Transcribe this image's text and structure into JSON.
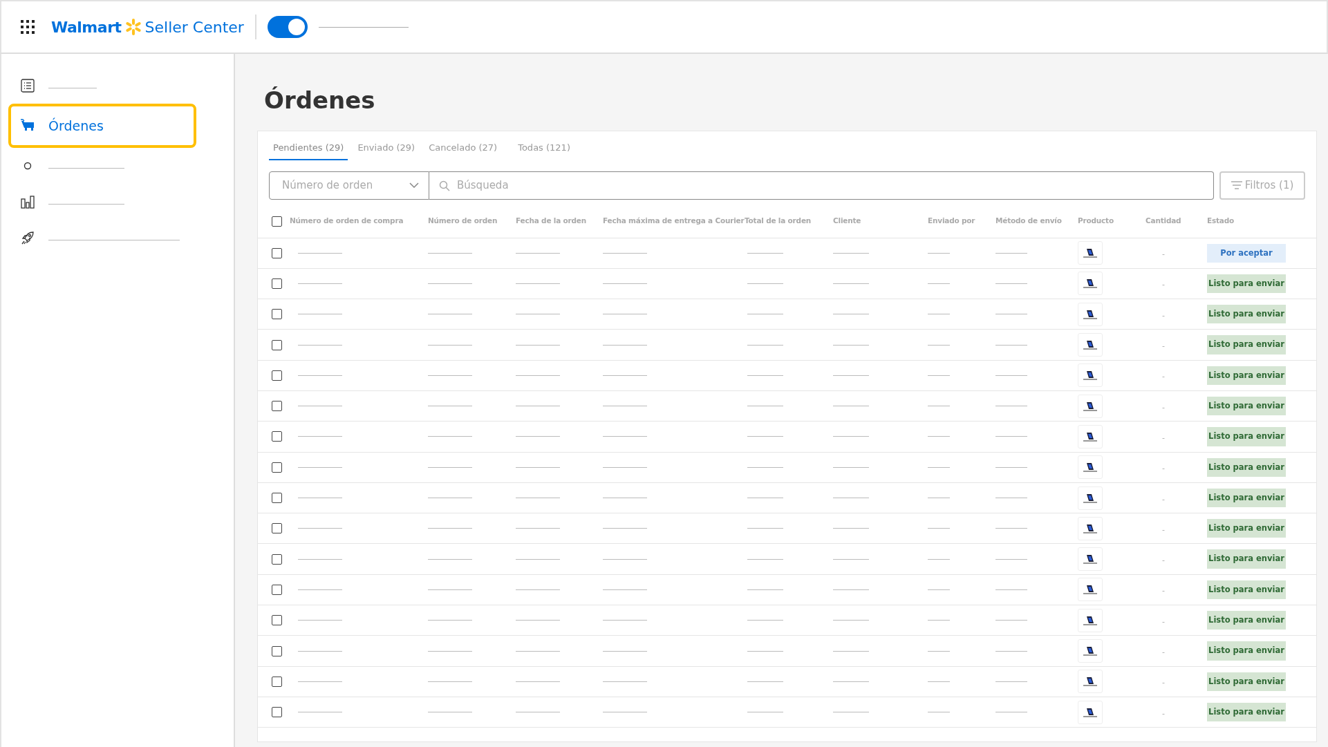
{
  "header": {
    "brand": "Walmart",
    "product": "Seller Center",
    "toggle": {
      "on": true
    }
  },
  "sidebar": {
    "items": [
      {
        "kind": "list",
        "selected": false
      },
      {
        "kind": "cart",
        "label": "Órdenes",
        "selected": true
      },
      {
        "kind": "circle",
        "selected": false
      },
      {
        "kind": "chart",
        "selected": false
      },
      {
        "kind": "rocket",
        "selected": false
      }
    ]
  },
  "page": {
    "title": "Órdenes"
  },
  "tabs": [
    {
      "label": "Pendientes (29)",
      "selected": true
    },
    {
      "label": "Enviado (29)",
      "selected": false
    },
    {
      "label": "Cancelado (27)",
      "selected": false
    },
    {
      "label": "Todas (121)",
      "selected": false
    }
  ],
  "search": {
    "dropdown": "Número de orden",
    "placeholder": "Búsqueda",
    "filters": "Filtros (1)"
  },
  "table": {
    "select_all": {
      "checked": false
    },
    "columns": [
      "Número de orden de compra",
      "Número de orden",
      "Fecha de la orden",
      "Fecha máxima de entrega a Courier",
      "Total de la orden",
      "Cliente",
      "Enviado por",
      "Método de envío",
      "Producto",
      "Cantidad",
      "Estado"
    ],
    "rows": [
      {
        "checked": false,
        "quantity": "-",
        "status": {
          "kind": "pending",
          "label": "Por aceptar"
        }
      },
      {
        "checked": false,
        "quantity": "-",
        "status": {
          "kind": "ready",
          "label": "Listo para enviar"
        }
      },
      {
        "checked": false,
        "quantity": "-",
        "status": {
          "kind": "ready",
          "label": "Listo para enviar"
        }
      },
      {
        "checked": false,
        "quantity": "-",
        "status": {
          "kind": "ready",
          "label": "Listo para enviar"
        }
      },
      {
        "checked": false,
        "quantity": "-",
        "status": {
          "kind": "ready",
          "label": "Listo para enviar"
        }
      },
      {
        "checked": false,
        "quantity": "-",
        "status": {
          "kind": "ready",
          "label": "Listo para enviar"
        }
      },
      {
        "checked": false,
        "quantity": "-",
        "status": {
          "kind": "ready",
          "label": "Listo para enviar"
        }
      },
      {
        "checked": false,
        "quantity": "-",
        "status": {
          "kind": "ready",
          "label": "Listo para enviar"
        }
      },
      {
        "checked": false,
        "quantity": "-",
        "status": {
          "kind": "ready",
          "label": "Listo para enviar"
        }
      },
      {
        "checked": false,
        "quantity": "-",
        "status": {
          "kind": "ready",
          "label": "Listo para enviar"
        }
      },
      {
        "checked": false,
        "quantity": "-",
        "status": {
          "kind": "ready",
          "label": "Listo para enviar"
        }
      },
      {
        "checked": false,
        "quantity": "-",
        "status": {
          "kind": "ready",
          "label": "Listo para enviar"
        }
      },
      {
        "checked": false,
        "quantity": "-",
        "status": {
          "kind": "ready",
          "label": "Listo para enviar"
        }
      },
      {
        "checked": false,
        "quantity": "-",
        "status": {
          "kind": "ready",
          "label": "Listo para enviar"
        }
      },
      {
        "checked": false,
        "quantity": "-",
        "status": {
          "kind": "ready",
          "label": "Listo para enviar"
        }
      },
      {
        "checked": false,
        "quantity": "-",
        "status": {
          "kind": "ready",
          "label": "Listo para enviar"
        }
      }
    ]
  }
}
